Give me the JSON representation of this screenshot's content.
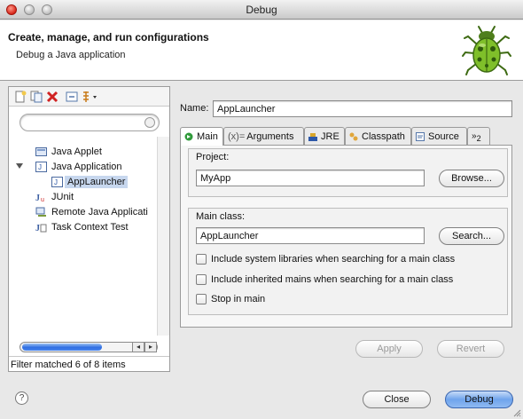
{
  "window": {
    "title": "Debug"
  },
  "header": {
    "title": "Create, manage, and run configurations",
    "subtitle": "Debug a Java application",
    "icon": "bug-icon"
  },
  "sidebar": {
    "toolbar_icons": [
      "new-config-icon",
      "duplicate-icon",
      "delete-icon",
      "collapse-all-icon",
      "filter-menu-icon"
    ],
    "filter_placeholder": "",
    "tree": [
      {
        "label": "Java Applet",
        "icon": "java-applet-icon",
        "level": 0
      },
      {
        "label": "Java Application",
        "icon": "java-application-icon",
        "level": 0,
        "expanded": true
      },
      {
        "label": "AppLauncher",
        "icon": "java-launch-icon",
        "level": 1,
        "selected": true
      },
      {
        "label": "JUnit",
        "icon": "junit-icon",
        "level": 0
      },
      {
        "label": "Remote Java Applicati",
        "icon": "remote-java-icon",
        "level": 0
      },
      {
        "label": "Task Context Test",
        "icon": "task-context-icon",
        "level": 0
      }
    ],
    "status": "Filter matched 6 of 8 items"
  },
  "config": {
    "name_label": "Name:",
    "name_value": "AppLauncher",
    "tabs": [
      {
        "label": "Main",
        "icon": "main-tab-icon",
        "active": true
      },
      {
        "label": "Arguments",
        "prefix": "(x)=",
        "icon": "arguments-icon"
      },
      {
        "label": "JRE",
        "icon": "jre-icon"
      },
      {
        "label": "Classpath",
        "icon": "classpath-icon"
      },
      {
        "label": "Source",
        "icon": "source-icon"
      },
      {
        "label": "2",
        "prefix": "»",
        "icon": "overflow-tabs-icon"
      }
    ],
    "project": {
      "label": "Project:",
      "value": "MyApp",
      "button": "Browse..."
    },
    "main_class": {
      "label": "Main class:",
      "value": "AppLauncher",
      "button": "Search..."
    },
    "options": [
      {
        "label": "Include system libraries when searching for a main class",
        "checked": false
      },
      {
        "label": "Include inherited mains when searching for a main class",
        "checked": false
      },
      {
        "label": "Stop in main",
        "checked": false
      }
    ],
    "apply": "Apply",
    "revert": "Revert"
  },
  "footer": {
    "help_glyph": "?",
    "close": "Close",
    "debug": "Debug"
  }
}
